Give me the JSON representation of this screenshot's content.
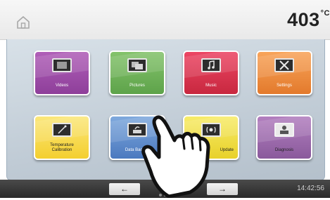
{
  "header": {
    "temperature": "403",
    "unit": "°C"
  },
  "tiles": [
    {
      "label": "Videos"
    },
    {
      "label": "Pictures"
    },
    {
      "label": "Music"
    },
    {
      "label": "Settings"
    },
    {
      "label": "Temperature\nCalibration"
    },
    {
      "label": "Data Backup"
    },
    {
      "label": "Update"
    },
    {
      "label": "Diagnosis"
    }
  ],
  "footer": {
    "prev": "←",
    "next": "→",
    "time": "14:42:56",
    "pages": 3,
    "current_page": 2
  },
  "icons": [
    "home-icon",
    "video-icon",
    "picture-icon",
    "music-icon",
    "settings-icon",
    "calibration-icon",
    "backup-icon",
    "update-icon",
    "diagnosis-icon"
  ],
  "colors": {
    "videos": "#9b4aa6",
    "pictures": "#6fb256",
    "music": "#da3350",
    "settings": "#ee8d40",
    "temperature": "#f7d94d",
    "data_backup": "#5f8fcf",
    "update": "#eedd3f",
    "diagnosis": "#9a6aab"
  }
}
